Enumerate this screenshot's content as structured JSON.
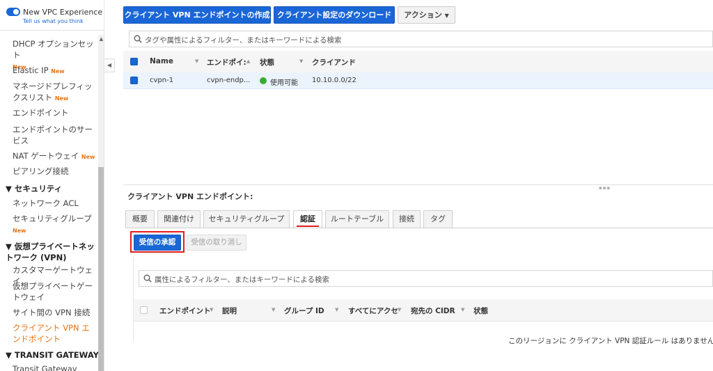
{
  "sidebar": {
    "new_vpc_title": "New VPC Experience",
    "new_vpc_sub": "Tell us what you think",
    "items": [
      {
        "label": "DHCP オプションセット",
        "badge": "New"
      },
      {
        "label": "Elastic IP",
        "badge": "New"
      },
      {
        "label": "マネージドプレフィックスリスト",
        "badge": "New"
      },
      {
        "label": "エンドポイント",
        "badge": ""
      },
      {
        "label": "エンドポイントのサービス",
        "badge": ""
      },
      {
        "label": "NAT ゲートウェイ",
        "badge": "New"
      },
      {
        "label": "ピアリング接続",
        "badge": ""
      }
    ],
    "section_security": "セキュリティ",
    "security_items": [
      {
        "label": "ネットワーク ACL",
        "badge": ""
      },
      {
        "label": "セキュリティグループ",
        "badge": "New"
      }
    ],
    "section_vpn": "仮想プライベートネットワーク (VPN)",
    "vpn_items": [
      {
        "label": "カスタマーゲートウェイ"
      },
      {
        "label": "仮想プライベートゲートウェイ"
      },
      {
        "label": "サイト間の VPN 接続"
      },
      {
        "label": "クライアント VPN エンドポイント"
      }
    ],
    "section_tgw": "TRANSIT GATEWAY",
    "tgw_items": [
      {
        "label": "Transit Gateway"
      }
    ]
  },
  "toolbar": {
    "create_label": "クライアント VPN エンドポイントの作成",
    "download_label": "クライアント設定のダウンロード",
    "actions_label": "アクション"
  },
  "top_search": {
    "placeholder": "タグや属性によるフィルター、またはキーワードによる検索"
  },
  "top_table": {
    "columns": [
      "Name",
      "エンドポイ:",
      "状態",
      "クライアント"
    ],
    "rows": [
      {
        "name": "cvpn-1",
        "endpoint": "cvpn-endp...",
        "status": "使用可能",
        "client": "10.10.0.0/22"
      }
    ]
  },
  "details": {
    "title": "クライアント VPN エンドポイント:",
    "tabs": [
      "概要",
      "関連付け",
      "セキュリティグループ",
      "認証",
      "ルートテーブル",
      "接続",
      "タグ"
    ],
    "active_tab": "認証",
    "authorize_label": "受信の承認",
    "revoke_label": "受信の取り消し",
    "search_placeholder": "属性によるフィルター、またはキーワードによる検索",
    "columns": [
      "エンドポイント",
      "説明",
      "グループ ID",
      "すべてにアクセ",
      "宛先の CIDR",
      "状態"
    ],
    "empty_message": "このリージョンに クライアント VPN 認証ルール はありません。"
  },
  "colors": {
    "primary": "#1a66d6",
    "accent_orange": "#ec7211",
    "highlight_red": "#e41b1b",
    "status_green": "#3aaa35"
  }
}
